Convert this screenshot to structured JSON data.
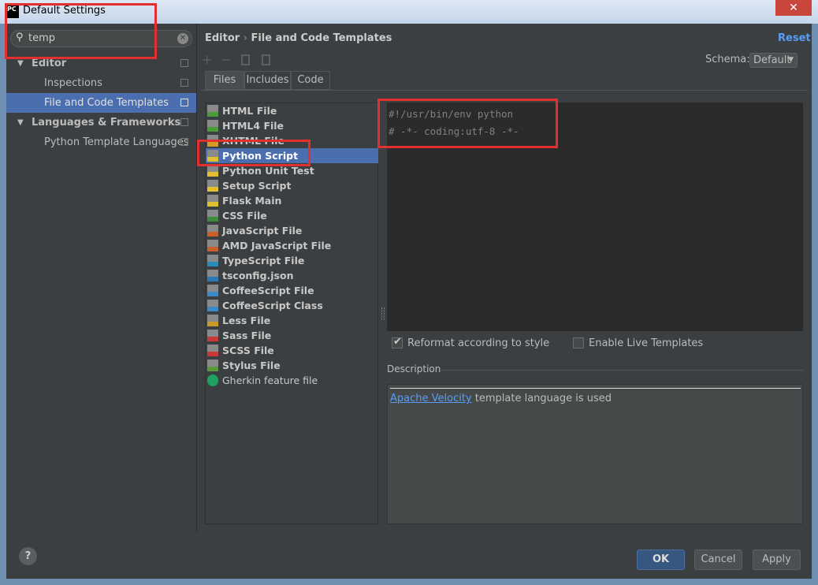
{
  "window": {
    "title": "Default Settings",
    "app_icon": "PC"
  },
  "search": {
    "value": "temp"
  },
  "tree": [
    {
      "label": "Editor",
      "type": "group"
    },
    {
      "label": "Inspections",
      "type": "item"
    },
    {
      "label": "File and Code Templates",
      "type": "item",
      "selected": true
    },
    {
      "label": "Languages & Frameworks",
      "type": "group"
    },
    {
      "label": "Python Template Languages",
      "type": "item"
    }
  ],
  "breadcrumb": {
    "parent": "Editor",
    "sep": "›",
    "current": "File and Code Templates"
  },
  "reset_label": "Reset",
  "schema": {
    "label": "Schema:",
    "value": "Default"
  },
  "tabs": [
    "Files",
    "Includes",
    "Code"
  ],
  "templates": [
    {
      "label": "HTML File",
      "icon": "html-file-icon",
      "color": "#4a9c3a"
    },
    {
      "label": "HTML4 File",
      "icon": "html-file-icon",
      "color": "#4a9c3a"
    },
    {
      "label": "XHTML File",
      "icon": "xhtml-file-icon",
      "color": "#d39b2a"
    },
    {
      "label": "Python Script",
      "icon": "python-icon",
      "color": "#e0c030",
      "selected": true
    },
    {
      "label": "Python Unit Test",
      "icon": "python-icon",
      "color": "#e0c030"
    },
    {
      "label": "Setup Script",
      "icon": "python-icon",
      "color": "#e0c030"
    },
    {
      "label": "Flask Main",
      "icon": "python-icon",
      "color": "#e0c030"
    },
    {
      "label": "CSS File",
      "icon": "css-file-icon",
      "color": "#3e8a3e"
    },
    {
      "label": "JavaScript File",
      "icon": "js-file-icon",
      "color": "#c8602a"
    },
    {
      "label": "AMD JavaScript File",
      "icon": "js-file-icon",
      "color": "#c8602a"
    },
    {
      "label": "TypeScript File",
      "icon": "ts-file-icon",
      "color": "#2a8ab8"
    },
    {
      "label": "tsconfig.json",
      "icon": "json-file-icon",
      "color": "#2a7ab8"
    },
    {
      "label": "CoffeeScript File",
      "icon": "coffeescript-icon",
      "color": "#3a8ac8"
    },
    {
      "label": "CoffeeScript Class",
      "icon": "coffeescript-icon",
      "color": "#3a8ac8"
    },
    {
      "label": "Less File",
      "icon": "less-file-icon",
      "color": "#c89a2a"
    },
    {
      "label": "Sass File",
      "icon": "sass-file-icon",
      "color": "#c83a3a"
    },
    {
      "label": "SCSS File",
      "icon": "scss-file-icon",
      "color": "#c83a3a"
    },
    {
      "label": "Stylus File",
      "icon": "stylus-file-icon",
      "color": "#5a9a3a"
    },
    {
      "label": "Gherkin feature file",
      "icon": "gherkin-icon",
      "color": "#1fa060"
    }
  ],
  "editor": {
    "lines": [
      "#!/usr/bin/env python",
      "# -*- coding:utf-8 -*-"
    ]
  },
  "options": {
    "reformat": {
      "label": "Reformat according to style",
      "checked": true
    },
    "live": {
      "label": "Enable Live Templates",
      "checked": false
    }
  },
  "description": {
    "label": "Description",
    "link": "Apache Velocity",
    "text": " template language is used"
  },
  "buttons": {
    "ok": "OK",
    "cancel": "Cancel",
    "apply": "Apply",
    "help": "?"
  }
}
